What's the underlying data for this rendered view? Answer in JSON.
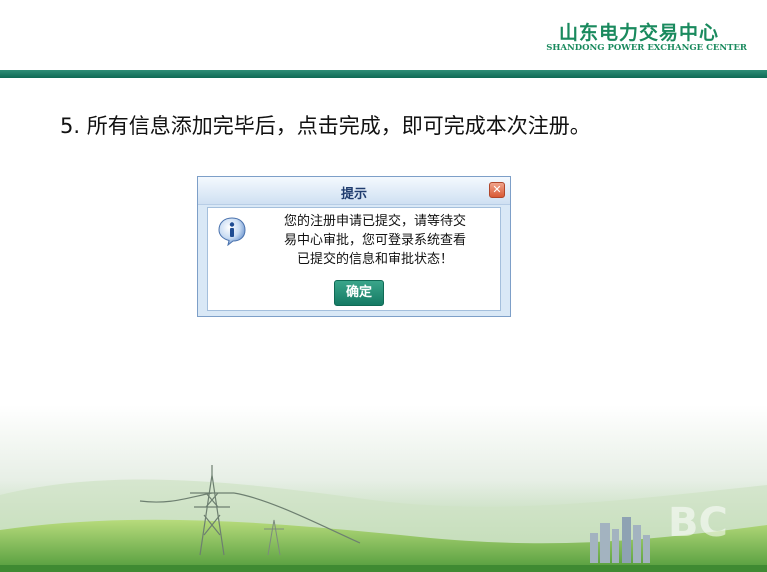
{
  "header": {
    "logo_cn": "山东电力交易中心",
    "logo_en": "SHANDONG POWER EXCHANGE CENTER"
  },
  "instruction": "5. 所有信息添加完毕后，点击完成，即可完成本次注册。",
  "dialog": {
    "title": "提示",
    "close_glyph": "✕",
    "message_lines": [
      "您的注册申请已提交，请等待交",
      "易中心审批，您可登录系统查看",
      "已提交的信息和审批状态！"
    ],
    "ok_label": "确定",
    "icon": "info-icon"
  },
  "colors": {
    "brand_green": "#1a8a5e",
    "band": "#0f6a55",
    "dialog_frame": "#d9e8f6"
  }
}
